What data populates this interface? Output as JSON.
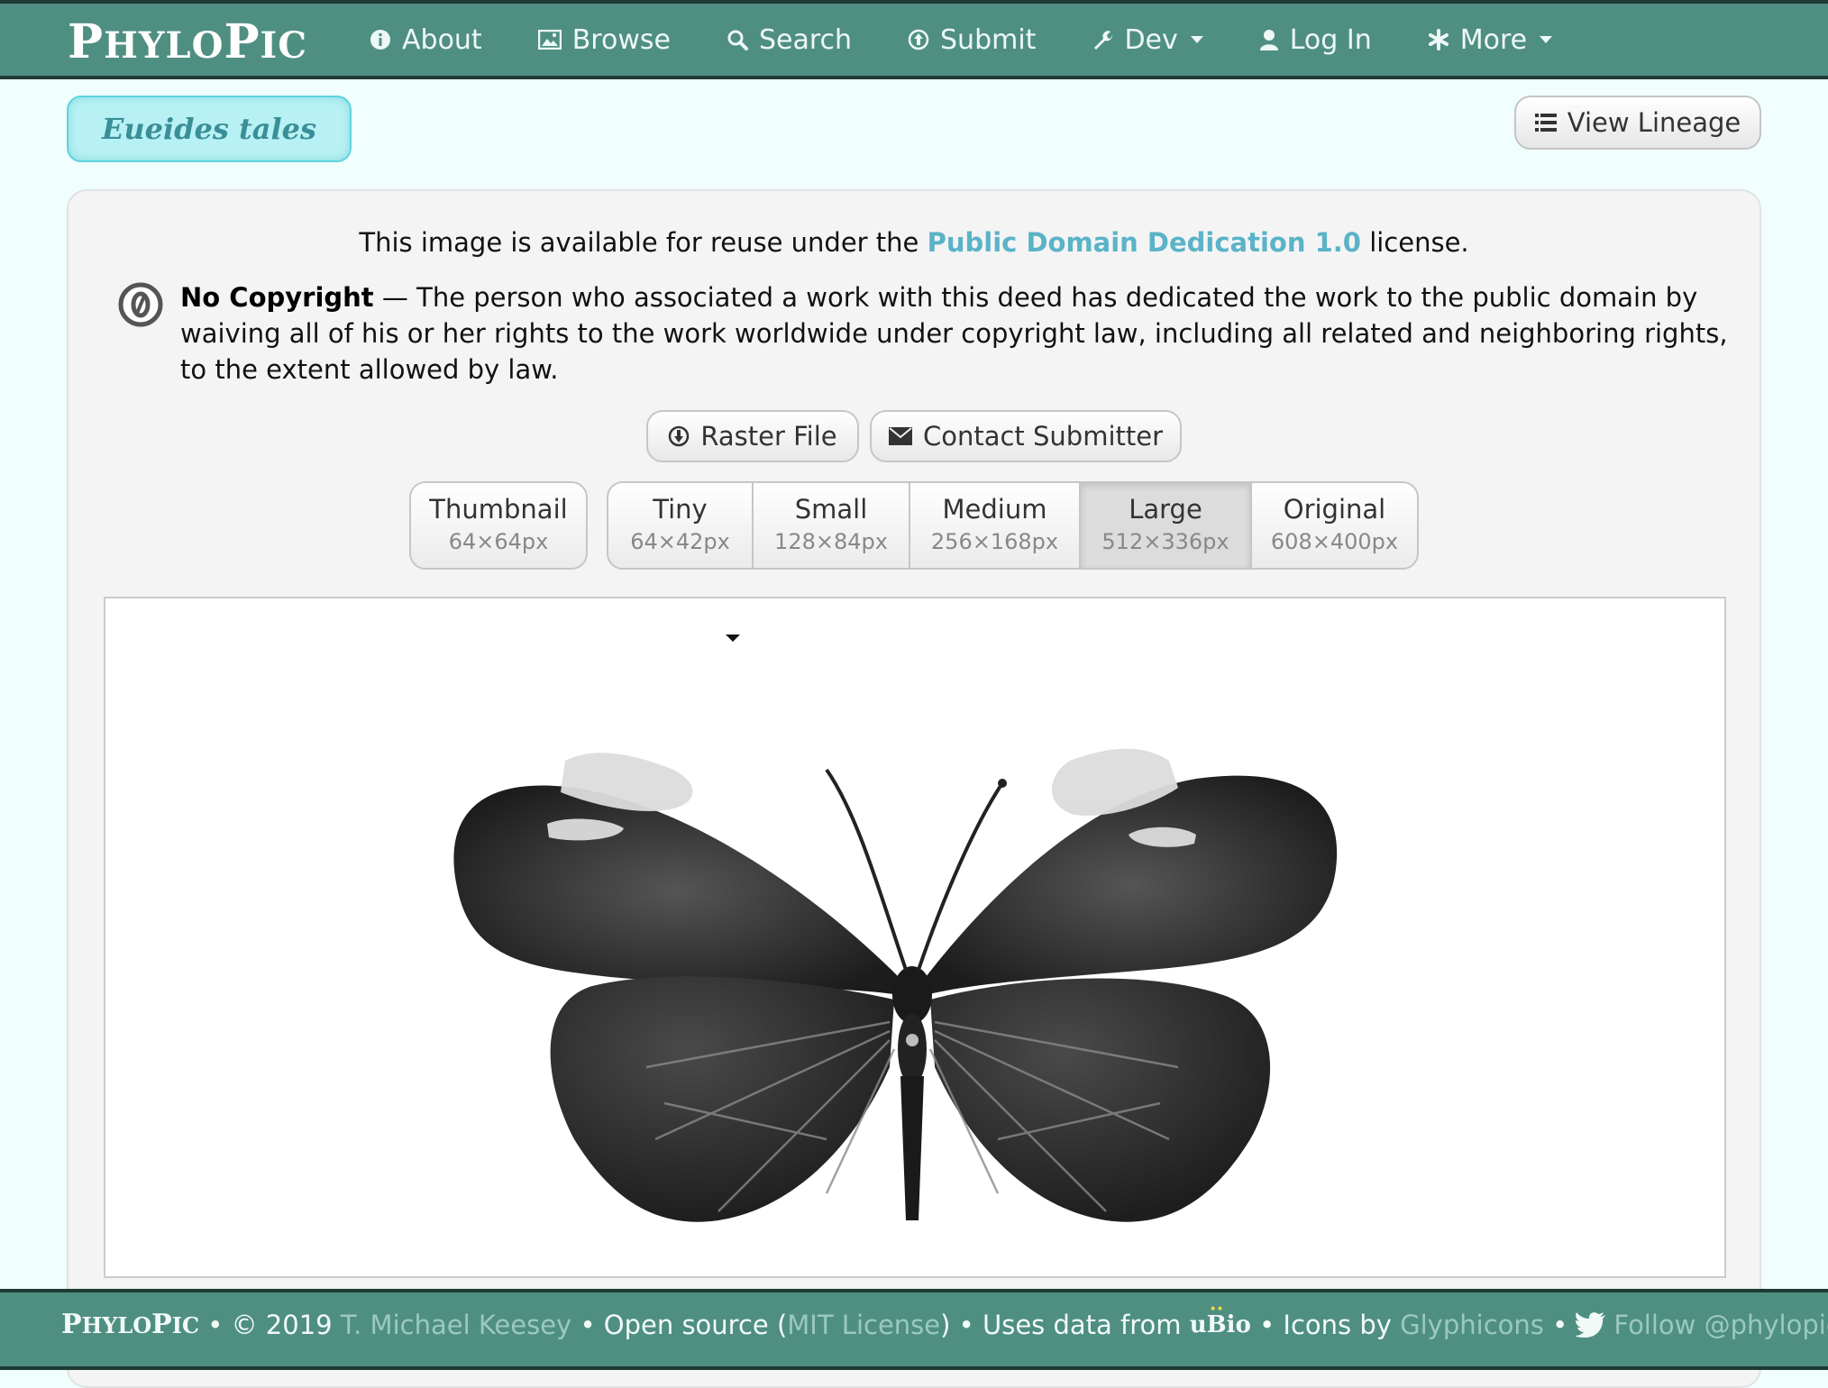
{
  "brand": {
    "first_big": "P",
    "first_rest": "HYLO",
    "second_big": "P",
    "second_rest": "IC"
  },
  "nav": {
    "items": [
      {
        "label": "About",
        "icon": "info-icon"
      },
      {
        "label": "Browse",
        "icon": "picture-icon"
      },
      {
        "label": "Search",
        "icon": "search-icon"
      },
      {
        "label": "Submit",
        "icon": "upload-icon"
      },
      {
        "label": "Dev",
        "icon": "wrench-icon",
        "dropdown": true
      },
      {
        "label": "Log In",
        "icon": "user-icon"
      },
      {
        "label": "More",
        "icon": "asterisk-icon",
        "dropdown": true
      }
    ]
  },
  "page": {
    "taxon_name": "Eueides tales",
    "view_lineage_label": "View Lineage"
  },
  "license": {
    "prefix": "This image is available for reuse under the",
    "link": "Public Domain Dedication 1.0",
    "suffix": "license.",
    "heading": "No Copyright",
    "body": " — The person who associated a work with this deed has dedicated the work to the public domain by waiving all of his or her rights to the work worldwide under copyright law, including all related and neighboring rights, to the extent allowed by law."
  },
  "actions": {
    "raster_label": "Raster File",
    "contact_label": "Contact Submitter"
  },
  "sizes": {
    "thumbnail": {
      "name": "Thumbnail",
      "dims": "64×64px"
    },
    "options": [
      {
        "name": "Tiny",
        "dims": "64×42px"
      },
      {
        "name": "Small",
        "dims": "128×84px"
      },
      {
        "name": "Medium",
        "dims": "256×168px"
      },
      {
        "name": "Large",
        "dims": "512×336px",
        "selected": true
      },
      {
        "name": "Original",
        "dims": "608×400px"
      }
    ]
  },
  "footer": {
    "brand_first_big": "P",
    "brand_first_rest": "HYLO",
    "brand_second_big": "P",
    "brand_second_rest": "IC",
    "copyright": "© 2019",
    "author": "T. Michael Keesey",
    "open_source": "Open source (",
    "license": "MIT License",
    "close_paren": ")",
    "uses_data": "Uses data from",
    "ubio": "uBio",
    "icons_by": "Icons by",
    "glyphicons": "Glyphicons",
    "follow": "Follow @phylopic",
    "bullet": "•"
  },
  "colors": {
    "navbar": "#4f8f82",
    "accent": "#5ab3c7",
    "pill": "#b8f1f4"
  }
}
